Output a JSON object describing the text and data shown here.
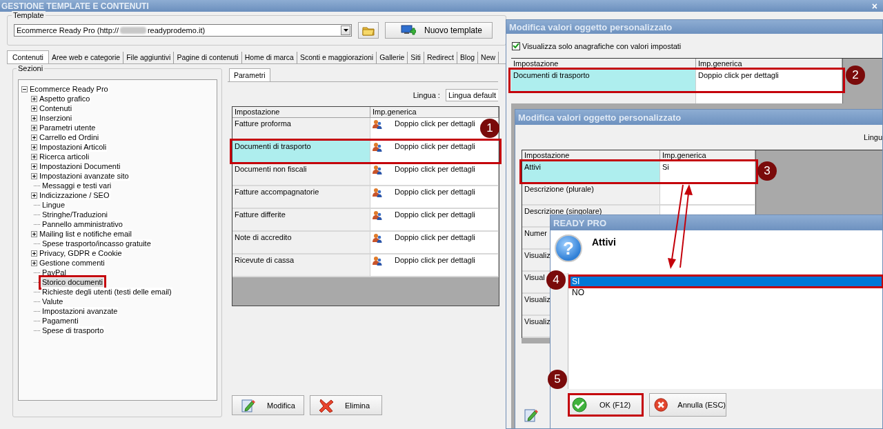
{
  "window": {
    "title": "GESTIONE TEMPLATE E CONTENUTI",
    "close_glyph": "×"
  },
  "template": {
    "label": "Template",
    "value_start": "Ecommerce Ready Pro (http://",
    "value_end": "readyprodemo.it)",
    "new_button": "Nuovo template"
  },
  "tabs": [
    {
      "label": "Contenuti",
      "selected": true
    },
    {
      "label": "Aree web e categorie",
      "selected": false
    },
    {
      "label": "File aggiuntivi",
      "selected": false
    },
    {
      "label": "Pagine di contenuti",
      "selected": false
    },
    {
      "label": "Home di marca",
      "selected": false
    },
    {
      "label": "Sconti e maggiorazioni",
      "selected": false
    },
    {
      "label": "Gallerie",
      "selected": false
    },
    {
      "label": "Siti",
      "selected": false
    },
    {
      "label": "Redirect",
      "selected": false
    },
    {
      "label": "Blog",
      "selected": false
    },
    {
      "label": "New",
      "selected": false
    }
  ],
  "sections": {
    "title": "Sezioni",
    "tree": [
      {
        "label": "Ecommerce Ready Pro",
        "kind": "folder",
        "expanded": true,
        "selected": false,
        "highlighted": false,
        "children": [
          {
            "label": "Aspetto grafico",
            "kind": "folder",
            "expanded": false,
            "selected": false,
            "highlighted": false
          },
          {
            "label": "Contenuti",
            "kind": "folder",
            "expanded": false,
            "selected": false,
            "highlighted": false
          },
          {
            "label": "Inserzioni",
            "kind": "folder",
            "expanded": false,
            "selected": false,
            "highlighted": false
          },
          {
            "label": "Parametri utente",
            "kind": "folder",
            "expanded": false,
            "selected": false,
            "highlighted": false
          },
          {
            "label": "Carrello ed Ordini",
            "kind": "folder",
            "expanded": false,
            "selected": false,
            "highlighted": false
          },
          {
            "label": "Impostazioni Articoli",
            "kind": "folder",
            "expanded": false,
            "selected": false,
            "highlighted": false
          },
          {
            "label": "Ricerca articoli",
            "kind": "folder",
            "expanded": false,
            "selected": false,
            "highlighted": false
          },
          {
            "label": "Impostazioni Documenti",
            "kind": "folder",
            "expanded": false,
            "selected": false,
            "highlighted": false
          },
          {
            "label": "Impostazioni avanzate sito",
            "kind": "folder",
            "expanded": false,
            "selected": false,
            "highlighted": false
          },
          {
            "label": "Messaggi e testi vari",
            "kind": "leaf",
            "selected": false,
            "highlighted": false
          },
          {
            "label": "Indicizzazione / SEO",
            "kind": "folder",
            "expanded": false,
            "selected": false,
            "highlighted": false
          },
          {
            "label": "Lingue",
            "kind": "leaf",
            "selected": false,
            "highlighted": false
          },
          {
            "label": "Stringhe/Traduzioni",
            "kind": "leaf",
            "selected": false,
            "highlighted": false
          },
          {
            "label": "Pannello amministrativo",
            "kind": "leaf",
            "selected": false,
            "highlighted": false
          },
          {
            "label": "Mailing list e notifiche email",
            "kind": "folder",
            "expanded": false,
            "selected": false,
            "highlighted": false
          },
          {
            "label": "Spese trasporto/incasso gratuite",
            "kind": "leaf",
            "selected": false,
            "highlighted": false
          },
          {
            "label": "Privacy, GDPR e Cookie",
            "kind": "folder",
            "expanded": false,
            "selected": false,
            "highlighted": false
          },
          {
            "label": "Gestione commenti",
            "kind": "folder",
            "expanded": false,
            "selected": false,
            "highlighted": false
          },
          {
            "label": "PayPal",
            "kind": "leaf",
            "selected": false,
            "highlighted": false
          },
          {
            "label": "Storico documenti",
            "kind": "leaf",
            "selected": true,
            "highlighted": true
          },
          {
            "label": "Richieste degli utenti (testi delle email)",
            "kind": "leaf",
            "selected": false,
            "highlighted": false
          },
          {
            "label": "Valute",
            "kind": "leaf",
            "selected": false,
            "highlighted": false
          },
          {
            "label": "Impostazioni avanzate",
            "kind": "leaf",
            "selected": false,
            "highlighted": false
          },
          {
            "label": "Pagamenti",
            "kind": "leaf",
            "selected": false,
            "highlighted": false
          },
          {
            "label": "Spese di trasporto",
            "kind": "leaf",
            "selected": false,
            "highlighted": false
          }
        ]
      }
    ]
  },
  "parameters": {
    "tab": "Parametri",
    "language_label": "Lingua :",
    "language_value": "Lingua default",
    "grid": {
      "columns": [
        "Impostazione",
        "Imp.generica"
      ],
      "value_icon": true,
      "rows": [
        {
          "setting": "Fatture proforma",
          "value": "Doppio click per dettagli",
          "selected": false,
          "highlighted": false
        },
        {
          "setting": "Documenti di trasporto",
          "value": "Doppio click per dettagli",
          "selected": true,
          "highlighted": true
        },
        {
          "setting": "Documenti non fiscali",
          "value": "Doppio click per dettagli",
          "selected": false,
          "highlighted": false
        },
        {
          "setting": "Fatture accompagnatorie",
          "value": "Doppio click per dettagli",
          "selected": false,
          "highlighted": false
        },
        {
          "setting": "Fatture differite",
          "value": "Doppio click per dettagli",
          "selected": false,
          "highlighted": false
        },
        {
          "setting": "Note di accredito",
          "value": "Doppio click per dettagli",
          "selected": false,
          "highlighted": false
        },
        {
          "setting": "Ricevute di cassa",
          "value": "Doppio click per dettagli",
          "selected": false,
          "highlighted": false
        }
      ]
    },
    "buttons": [
      {
        "label": "Modifica",
        "kind": "edit"
      },
      {
        "label": "Elimina",
        "kind": "delete"
      }
    ]
  },
  "dialog_values": {
    "title": "Modifica valori oggetto personalizzato",
    "checkbox": {
      "label": "Visualizza solo anagrafiche con valori impostati",
      "checked": true
    },
    "grid": {
      "columns": [
        "Impostazione",
        "Imp.generica"
      ],
      "rows": [
        {
          "setting": "Documenti di trasporto",
          "value": "Doppio click per dettagli",
          "selected": true,
          "highlighted": true
        }
      ]
    }
  },
  "dialog_details": {
    "title": "Modifica valori oggetto personalizzato",
    "language_label": "Lingu",
    "grid": {
      "columns": [
        "Impostazione",
        "Imp.generica"
      ],
      "rows": [
        {
          "setting": "Attivi",
          "value": "Si",
          "selected": true,
          "highlighted": true
        },
        {
          "setting": "Descrizione (plurale)",
          "selected": false,
          "highlighted": false
        },
        {
          "setting": "Descrizione (singolare)",
          "selected": false,
          "highlighted": false
        },
        {
          "setting": "Numer",
          "selected": false,
          "highlighted": false
        },
        {
          "setting": "Visualiz",
          "selected": false,
          "highlighted": false
        },
        {
          "setting": "Visual",
          "selected": false,
          "highlighted": false
        },
        {
          "setting": "Visualiz",
          "selected": false,
          "highlighted": false
        },
        {
          "setting": "Visualiz",
          "selected": false,
          "highlighted": false
        }
      ]
    }
  },
  "dialog_choice": {
    "title": "READY PRO",
    "icon_glyph": "?",
    "prompt": "Attivi",
    "options": [
      {
        "label": "SI",
        "selected": true,
        "highlighted": true
      },
      {
        "label": "NO",
        "selected": false,
        "highlighted": false
      }
    ],
    "buttons": [
      {
        "label": "OK (F12)",
        "kind": "ok",
        "highlighted": true
      },
      {
        "label": "Annulla (ESC)",
        "kind": "cancel",
        "highlighted": false
      }
    ]
  },
  "callouts": [
    "1",
    "2",
    "3",
    "4",
    "5"
  ]
}
